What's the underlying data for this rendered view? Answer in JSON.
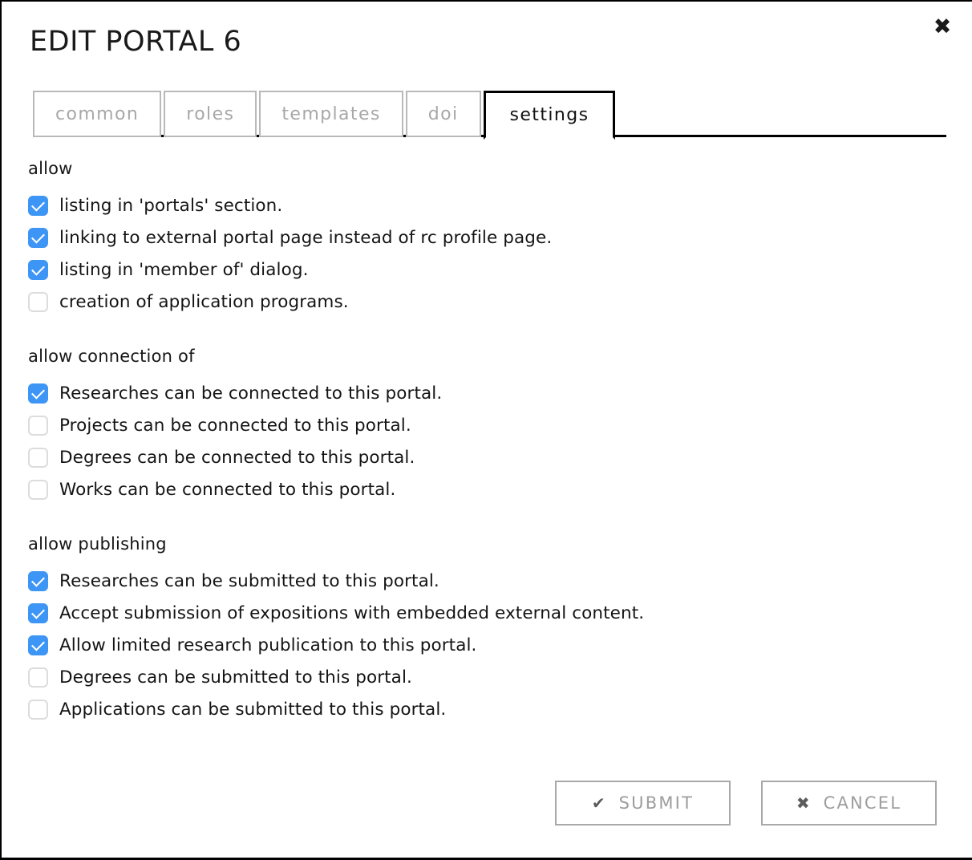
{
  "dialog": {
    "title": "EDIT PORTAL 6",
    "close_icon": "close-icon",
    "close_glyph": "✖"
  },
  "tabs": [
    {
      "label": "common",
      "active": false
    },
    {
      "label": "roles",
      "active": false
    },
    {
      "label": "templates",
      "active": false
    },
    {
      "label": "doi",
      "active": false
    },
    {
      "label": "settings",
      "active": true
    }
  ],
  "sections": [
    {
      "title": "allow",
      "items": [
        {
          "label": "listing in 'portals' section.",
          "checked": true
        },
        {
          "label": "linking to external portal page instead of rc profile page.",
          "checked": true
        },
        {
          "label": "listing in 'member of' dialog.",
          "checked": true
        },
        {
          "label": "creation of application programs.",
          "checked": false
        }
      ]
    },
    {
      "title": "allow connection of",
      "items": [
        {
          "label": "Researches can be connected to this portal.",
          "checked": true
        },
        {
          "label": "Projects can be connected to this portal.",
          "checked": false
        },
        {
          "label": "Degrees can be connected to this portal.",
          "checked": false
        },
        {
          "label": "Works can be connected to this portal.",
          "checked": false
        }
      ]
    },
    {
      "title": "allow publishing",
      "items": [
        {
          "label": "Researches can be submitted to this portal.",
          "checked": true
        },
        {
          "label": "Accept submission of expositions with embedded external content.",
          "checked": true
        },
        {
          "label": "Allow limited research publication to this portal.",
          "checked": true
        },
        {
          "label": "Degrees can be submitted to this portal.",
          "checked": false
        },
        {
          "label": "Applications can be submitted to this portal.",
          "checked": false
        }
      ]
    }
  ],
  "footer": {
    "submit": {
      "label": "SUBMIT",
      "icon": "check-icon",
      "glyph": "✔"
    },
    "cancel": {
      "label": "CANCEL",
      "icon": "cross-icon",
      "glyph": "✖"
    }
  },
  "colors": {
    "checkbox_on": "#3d95f5",
    "checkbox_off_border": "#dcdcdc",
    "tab_inactive_text": "#a8a8a8",
    "tab_active_border": "#000000",
    "button_text": "#9d9d9d",
    "button_border": "#a9a9a9"
  }
}
